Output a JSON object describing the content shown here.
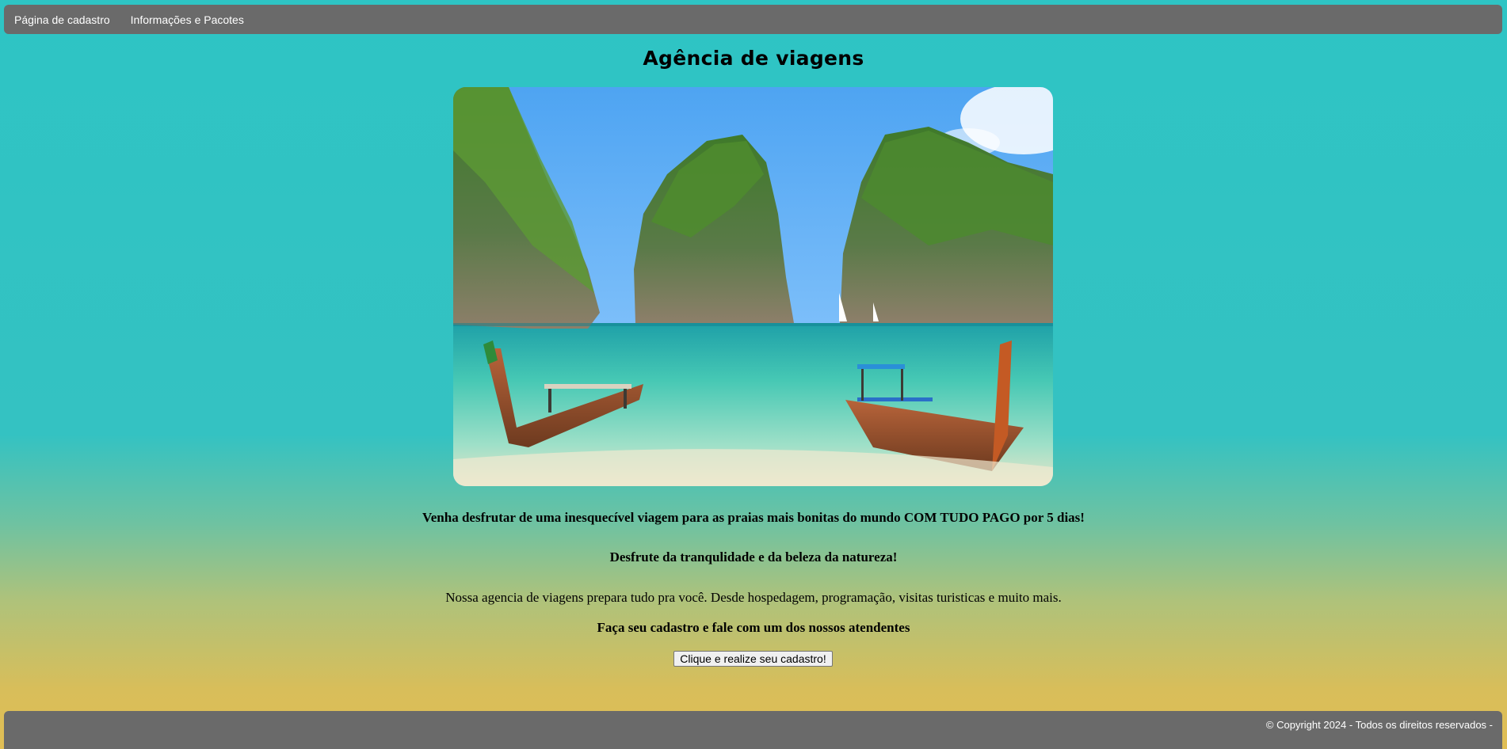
{
  "nav": {
    "items": [
      {
        "label": "Página de cadastro"
      },
      {
        "label": "Informações e Pacotes"
      }
    ]
  },
  "main": {
    "title": "Agência de viagens",
    "hero_image": "tropical-beach-longtail-boats-photo",
    "line1": "Venha desfrutar de uma inesquecível viagem para as praias mais bonitas do mundo COM TUDO PAGO por 5 dias!",
    "line2": "Desfrute da tranqulidade e da beleza da natureza!",
    "line3": "Nossa agencia de viagens prepara tudo pra você. Desde hospedagem, programação, visitas turisticas e muito mais.",
    "line4": "Faça seu cadastro e fale com um dos nossos atendentes",
    "cta_label": "Clique e realize seu cadastro!"
  },
  "footer": {
    "text": "© Copyright 2024 - Todos os direitos reservados -"
  },
  "colors": {
    "nav_bg": "#6a6a6a",
    "bg_top": "#2ec4c4",
    "bg_bottom": "#e0be55"
  }
}
